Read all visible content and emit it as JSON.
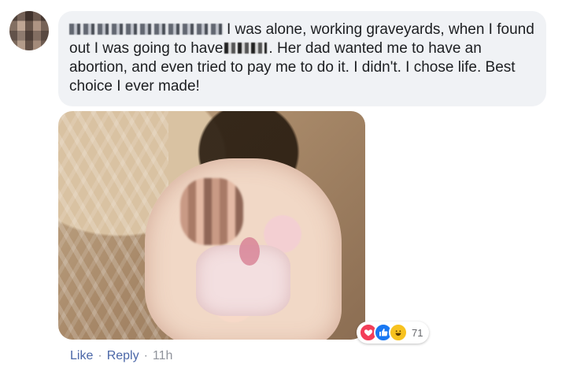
{
  "comment": {
    "author_name": "",
    "text_part1": "I was alone, working graveyards, when I found out I was going to have",
    "text_part2": ". Her dad wanted me to have an abortion, and even tried to pay me to do it. I didn't. I chose life. Best choice I ever made!"
  },
  "reactions": {
    "icons": [
      "love-icon",
      "like-icon",
      "haha-icon"
    ],
    "count": "71"
  },
  "actions": {
    "like_label": "Like",
    "separator": "·",
    "reply_label": "Reply",
    "timestamp": "11h"
  },
  "colors": {
    "bubble_bg": "#f0f2f5",
    "link": "#4b67a8",
    "love": "#f33e58",
    "like": "#1877f2",
    "haha": "#f7c21f"
  }
}
